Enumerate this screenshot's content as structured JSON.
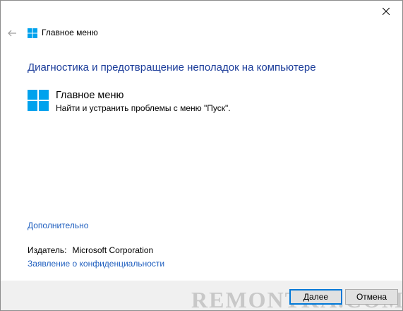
{
  "window": {
    "title": "Главное меню",
    "close_icon": "close-icon",
    "back_icon": "back-arrow-icon"
  },
  "main": {
    "heading": "Диагностика и предотвращение неполадок на компьютере",
    "item": {
      "icon": "windows-logo-icon",
      "title": "Главное меню",
      "description": "Найти и устранить проблемы с меню \"Пуск\"."
    },
    "advanced_link": "Дополнительно",
    "publisher": {
      "label": "Издатель:",
      "value": "Microsoft Corporation"
    },
    "privacy_link": "Заявление о конфиденциальности"
  },
  "footer": {
    "watermark": "REMONTKA.COM",
    "next_label": "Далее",
    "cancel_label": "Отмена"
  },
  "colors": {
    "heading": "#1c3d9a",
    "link": "#1f5fbf",
    "windows_logo": "#00a2ed",
    "footer_bg": "#f0f0f0",
    "default_button_border": "#0078d7"
  }
}
